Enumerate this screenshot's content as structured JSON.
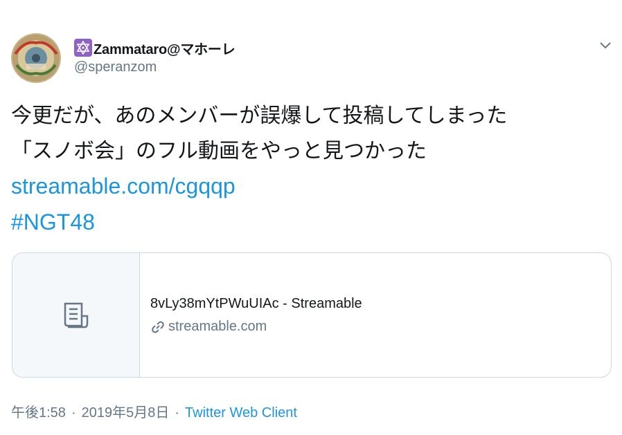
{
  "user": {
    "display_name": "Zammataro@マホーレ",
    "handle": "@speranzom",
    "badge_icon": "six-pointed-star-icon",
    "badge_color": "#8f63c5"
  },
  "tweet": {
    "lines": [
      "今更だが、あのメンバーが誤爆して投稿してしまった",
      "「スノボ会」のフル動画をやっと見つかった"
    ],
    "link": "streamable.com/cgqqp",
    "hashtag": "#NGT48"
  },
  "card": {
    "title": "8vLy38mYtPWuUIAc - Streamable",
    "domain": "streamable.com",
    "thumb_icon": "document-icon",
    "domain_icon": "link-icon"
  },
  "meta": {
    "time": "午後1:58",
    "separator": "·",
    "date": "2019年5月8日",
    "client": "Twitter Web Client"
  },
  "colors": {
    "link": "#1b95e0",
    "secondary_text": "#657786",
    "border": "#ccd6dd"
  }
}
